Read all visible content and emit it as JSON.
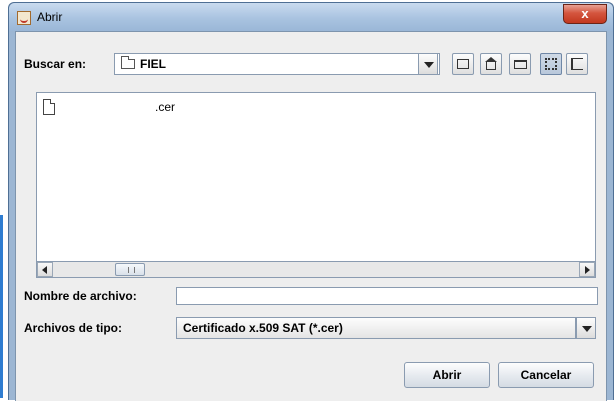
{
  "window": {
    "title": "Abrir",
    "close_label": "x"
  },
  "lookin": {
    "label": "Buscar en:",
    "value": "FIEL"
  },
  "toolbar": {
    "icons": [
      "up-one-level-icon",
      "home-icon",
      "new-folder-icon",
      "list-view-icon",
      "details-view-icon"
    ]
  },
  "files": [
    {
      "name": ".cer"
    }
  ],
  "filename": {
    "label": "Nombre de archivo:",
    "value": ""
  },
  "filetype": {
    "label": "Archivos de tipo:",
    "value": "Certificado x.509 SAT (*.cer)"
  },
  "buttons": {
    "open": "Abrir",
    "cancel": "Cancelar"
  }
}
